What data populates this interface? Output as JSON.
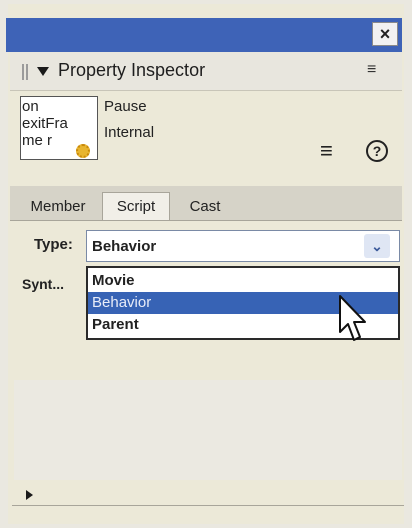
{
  "window": {
    "close_glyph": "×"
  },
  "panel": {
    "title": "Property Inspector"
  },
  "thumbnail": {
    "text": "on\nexitFra\nme r"
  },
  "properties": {
    "pause": "Pause",
    "internal": "Internal"
  },
  "tabs": [
    {
      "label": "Member",
      "active": false
    },
    {
      "label": "Script",
      "active": true
    },
    {
      "label": "Cast",
      "active": false
    }
  ],
  "type_field": {
    "label": "Type:",
    "value": "Behavior",
    "options": [
      "Movie",
      "Behavior",
      "Parent"
    ],
    "highlighted": "Behavior"
  },
  "syntax": {
    "label": "Synt..."
  },
  "icons": {
    "menu": "list-settings-icon",
    "list": "list-view-icon",
    "help": "help-icon",
    "collapse": "triangle-down-icon",
    "expand": "triangle-right-icon",
    "cursor": "mouse-pointer-icon",
    "behavior": "gear-icon"
  },
  "colors": {
    "titlebar": "#3e63b7",
    "highlight": "#3763b5"
  }
}
